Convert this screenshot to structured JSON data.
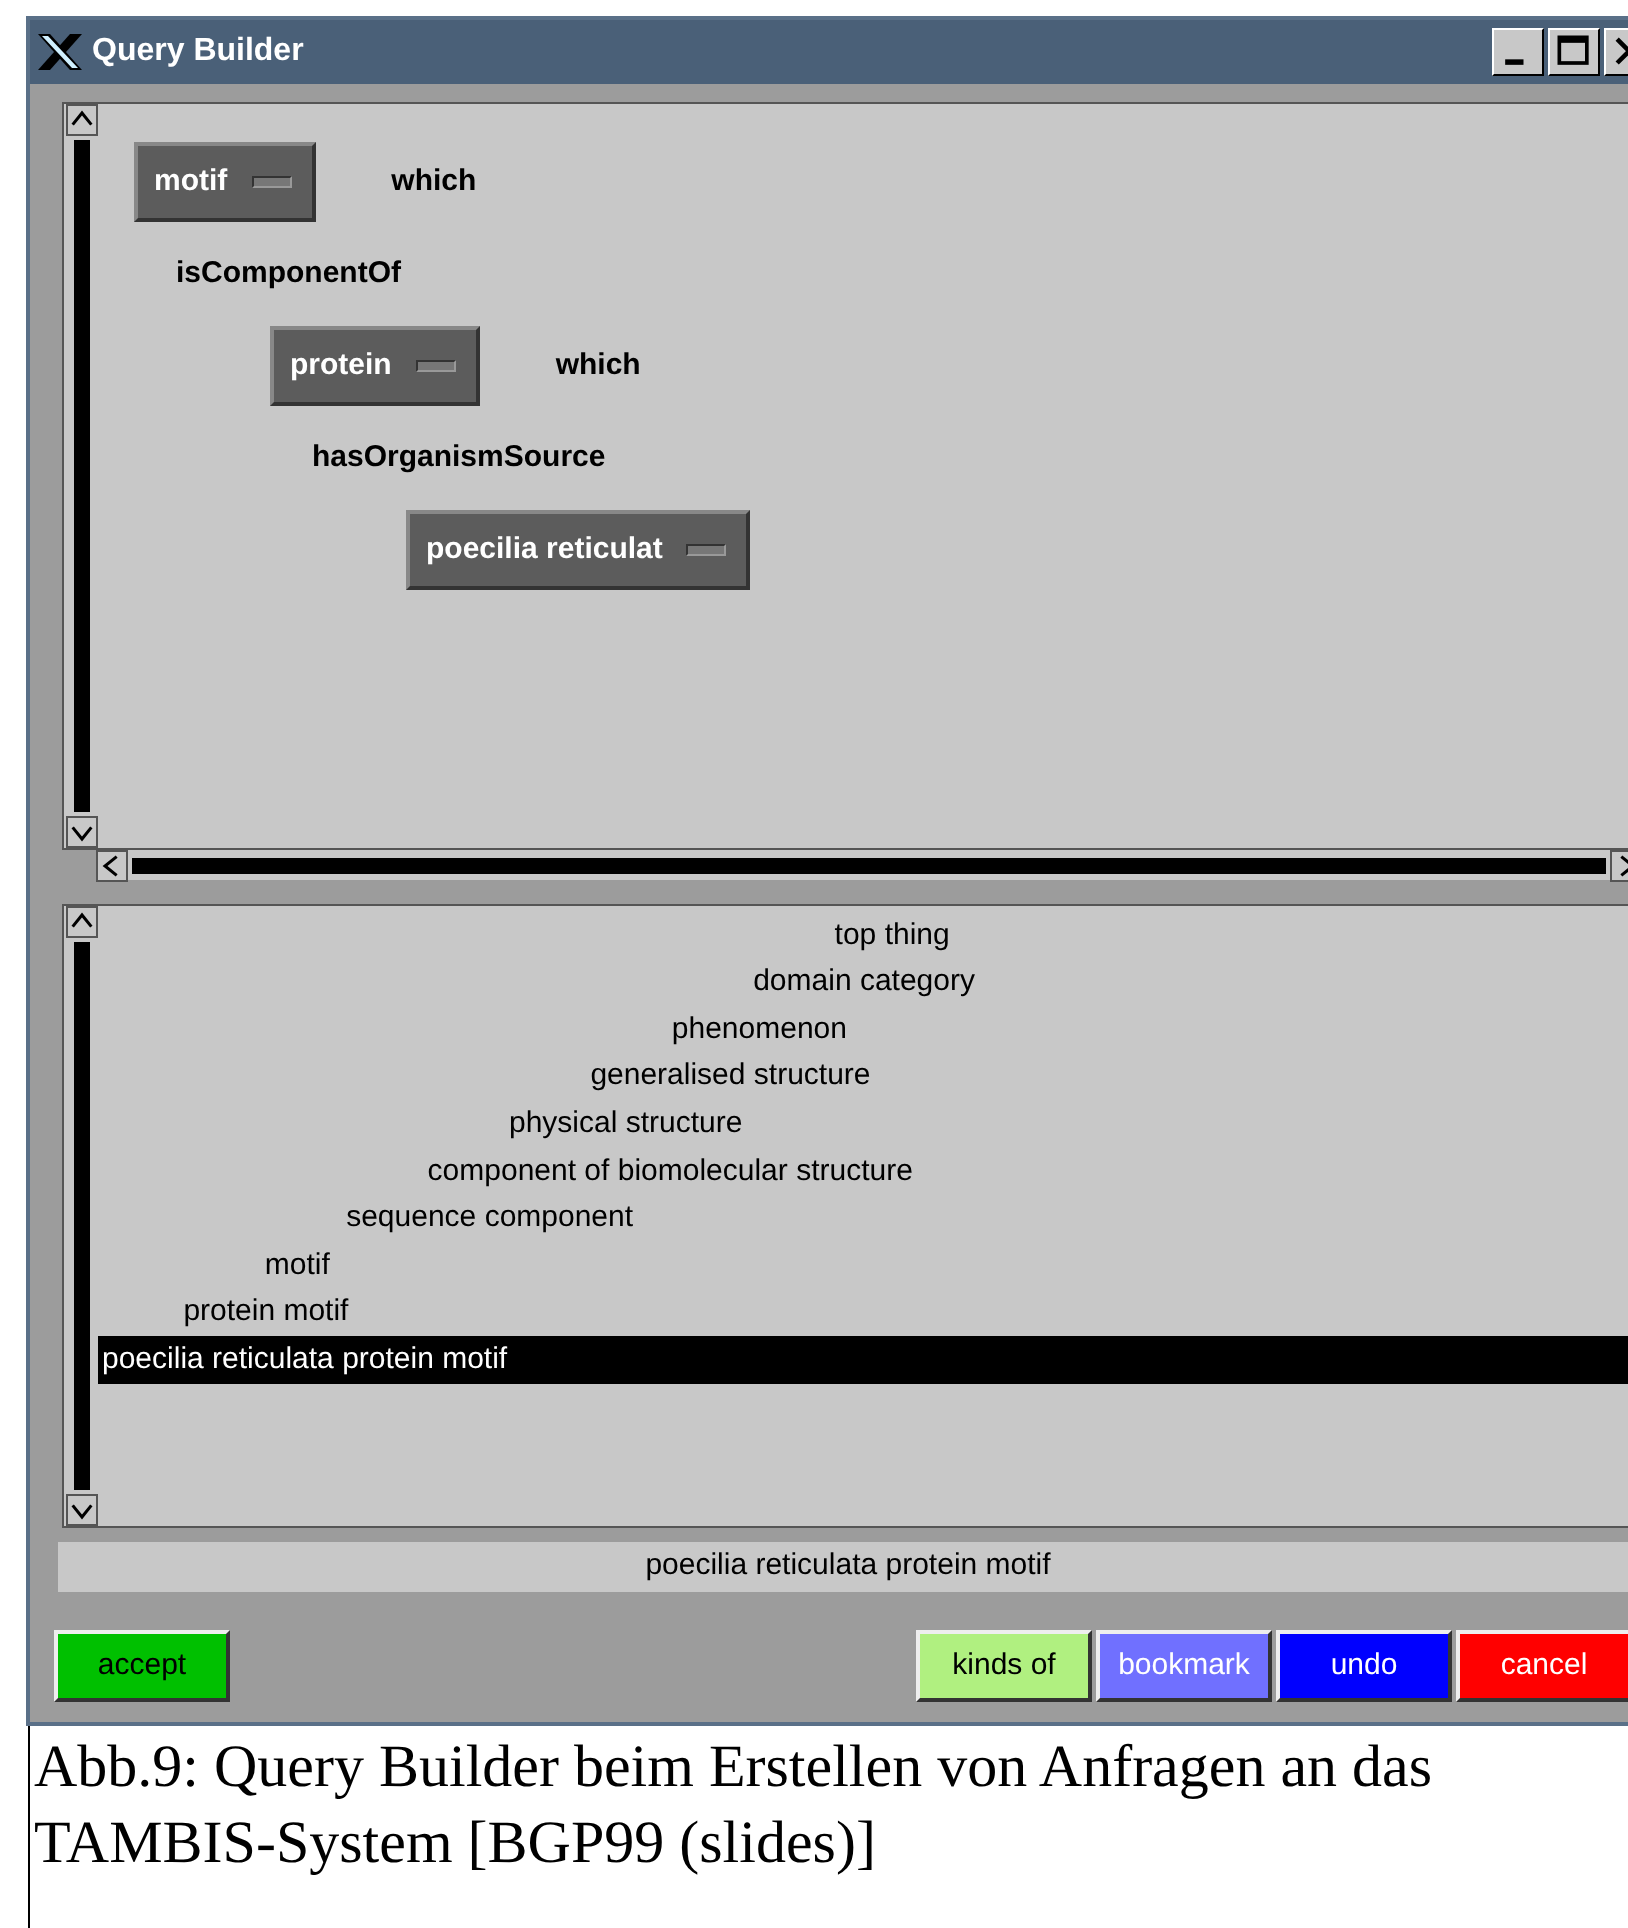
{
  "window": {
    "title": "Query Builder"
  },
  "query": [
    {
      "concept": "motif",
      "connector": "which",
      "relation": "isComponentOf",
      "children": [
        {
          "concept": "protein",
          "connector": "which",
          "relation": "hasOrganismSource",
          "children": [
            {
              "concept": "poecilia reticulat"
            }
          ]
        }
      ]
    }
  ],
  "hierarchy": [
    {
      "label": "top thing",
      "selected": false
    },
    {
      "label": "domain category",
      "selected": false
    },
    {
      "label": "phenomenon",
      "selected": false
    },
    {
      "label": "generalised structure",
      "selected": false
    },
    {
      "label": "physical structure",
      "selected": false
    },
    {
      "label": "component of biomolecular structure",
      "selected": false
    },
    {
      "label": "sequence component",
      "selected": false
    },
    {
      "label": "motif",
      "selected": false
    },
    {
      "label": "protein motif",
      "selected": false
    },
    {
      "label": "poecilia reticulata protein motif",
      "selected": true
    }
  ],
  "status_bar": "poecilia reticulata protein motif",
  "buttons_left": [
    {
      "label": "accept",
      "color": "#00c000"
    }
  ],
  "buttons_right": [
    {
      "label": "kinds of",
      "color": "#b0f080"
    },
    {
      "label": "bookmark",
      "color": "#7070ff"
    },
    {
      "label": "undo",
      "color": "#0000ff"
    },
    {
      "label": "cancel",
      "color": "#ff0000"
    }
  ],
  "caption": "Abb.9: Query Builder beim Erstellen von Anfragen an das TAMBIS-System [BGP99 (slides)]"
}
